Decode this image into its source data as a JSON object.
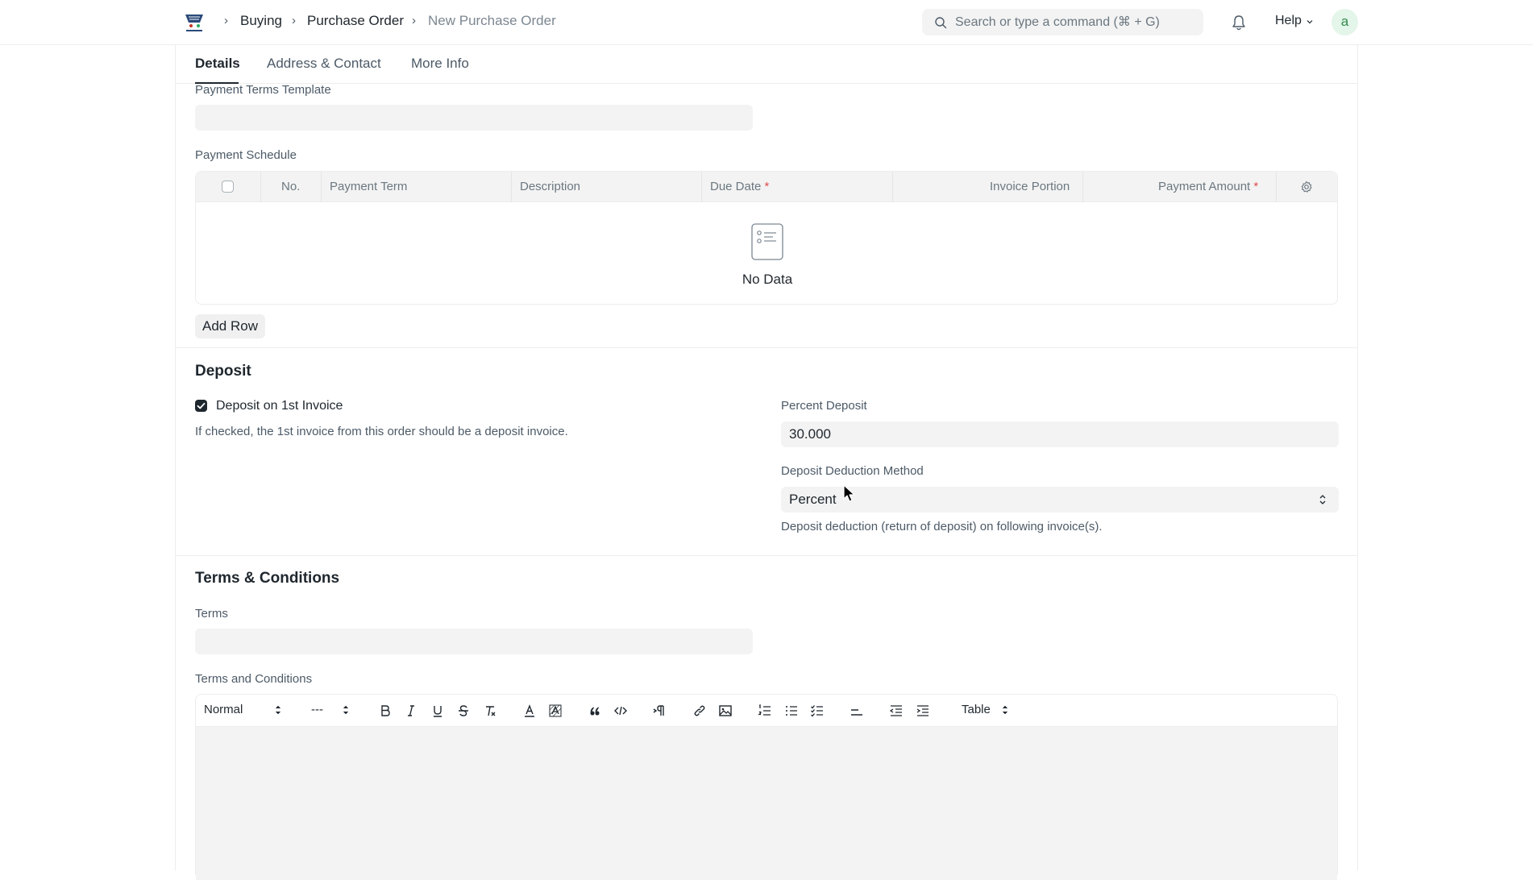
{
  "navbar": {
    "breadcrumbs": [
      "Buying",
      "Purchase Order",
      "New Purchase Order"
    ],
    "search_placeholder": "Search or type a command (⌘ + G)",
    "help_label": "Help",
    "avatar_letter": "a"
  },
  "tabs": [
    {
      "label": "Details",
      "active": true
    },
    {
      "label": "Address & Contact",
      "active": false
    },
    {
      "label": "More Info",
      "active": false
    }
  ],
  "payment": {
    "template_label": "Payment Terms Template",
    "template_value": "",
    "schedule_label": "Payment Schedule",
    "columns": [
      "No.",
      "Payment Term",
      "Description",
      "Due Date",
      "Invoice Portion",
      "Payment Amount"
    ],
    "required_mark": "*",
    "empty_text": "No Data",
    "add_row_label": "Add Row"
  },
  "deposit": {
    "title": "Deposit",
    "checkbox_label": "Deposit on 1st Invoice",
    "checkbox_checked": true,
    "checkbox_help": "If checked, the 1st invoice from this order should be a deposit invoice.",
    "percent_label": "Percent Deposit",
    "percent_value": "30.000",
    "method_label": "Deposit Deduction Method",
    "method_value": "Percent",
    "method_help": "Deposit deduction (return of deposit) on following invoice(s)."
  },
  "terms": {
    "title": "Terms & Conditions",
    "terms_label": "Terms",
    "terms_value": "",
    "editor_label": "Terms and Conditions",
    "toolbar": {
      "format_select": "Normal",
      "size_select": "---",
      "table_select": "Table"
    }
  },
  "colors": {
    "text": "#1f272e",
    "muted": "#4c5a67",
    "field_bg": "#f3f3f3",
    "required": "#e24c4c",
    "avatar_bg": "#e4f5e9",
    "avatar_fg": "#318a4d"
  }
}
